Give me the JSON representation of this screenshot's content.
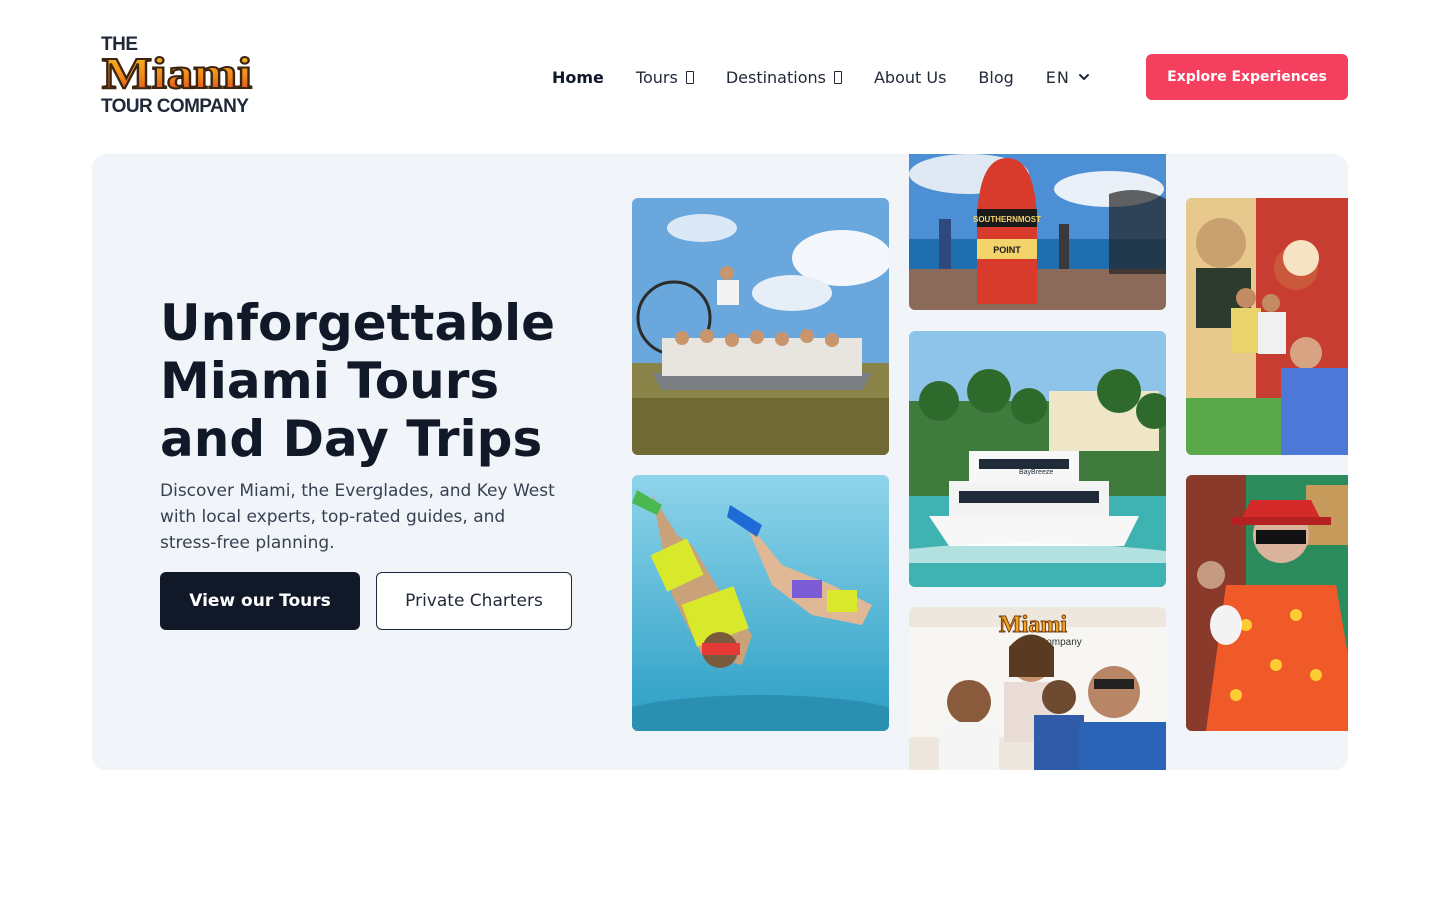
{
  "brand": {
    "line1": "THE",
    "name": "Miami",
    "line3": "TOUR COMPANY"
  },
  "nav": {
    "items": [
      {
        "label": "Home",
        "active": true
      },
      {
        "label": "Tours",
        "icon": "dropdown-icon"
      },
      {
        "label": "Destinations",
        "icon": "dropdown-icon"
      },
      {
        "label": "About Us"
      },
      {
        "label": "Blog"
      }
    ],
    "language": "EN",
    "cta": "Explore Experiences"
  },
  "hero": {
    "title": "Unforgettable Miami Tours and Day Trips",
    "subtitle": "Discover Miami, the Everglades, and Key West with local experts, top-rated guides, and stress-free planning.",
    "primary_button": "View our Tours",
    "secondary_button": "Private Charters"
  },
  "photo_signs": {
    "buoy_line1": "SOUTHERNMOST",
    "buoy_line2": "POINT",
    "boat_name": "BayBreeze",
    "van_brand": "Miami",
    "van_line2": "Company"
  },
  "colors": {
    "accent": "#f43f5e",
    "dark": "#111827",
    "hero_bg": "#f1f5f9"
  }
}
